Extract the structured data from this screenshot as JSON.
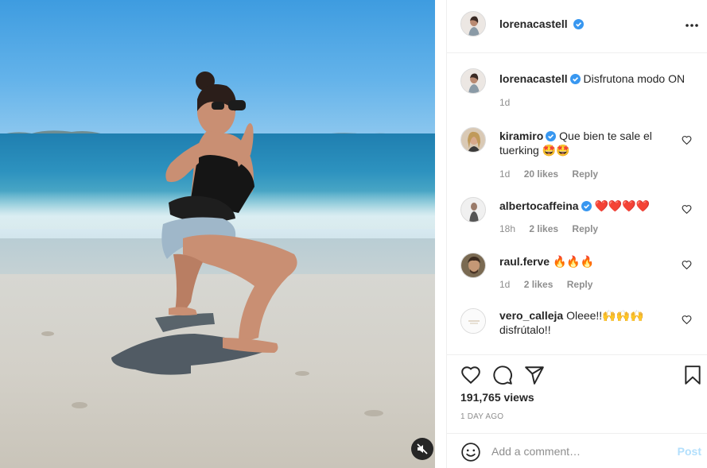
{
  "post": {
    "author": "lorenacastell",
    "caption": "Disfrutona modo ON",
    "caption_time": "1d",
    "views": "191,765 views",
    "posted_ago": "1 DAY AGO"
  },
  "comments": [
    {
      "user": "kiramiro",
      "verified": true,
      "text": "Que bien te sale el tuerking 🤩🤩",
      "time": "1d",
      "likes": "20 likes",
      "reply": "Reply"
    },
    {
      "user": "albertocaffeina",
      "verified": true,
      "text": "❤️❤️❤️❤️",
      "time": "18h",
      "likes": "2 likes",
      "reply": "Reply"
    },
    {
      "user": "raul.ferve",
      "verified": false,
      "text": "🔥🔥🔥",
      "time": "1d",
      "likes": "2 likes",
      "reply": "Reply"
    },
    {
      "user": "vero_calleja",
      "verified": false,
      "text": "Oleee!!🙌🙌🙌 disfrútalo!!",
      "time": "",
      "likes": "",
      "reply": ""
    }
  ],
  "add_comment": {
    "placeholder": "Add a comment…",
    "post_label": "Post"
  },
  "icons": {
    "more": "more-options-icon",
    "like": "heart-icon",
    "comment": "comment-icon",
    "share": "share-icon",
    "save": "bookmark-icon",
    "emoji": "smile-icon",
    "mute": "muted-speaker-icon",
    "verified": "verified-badge-icon"
  },
  "colors": {
    "verified": "#3897f0",
    "post_disabled": "#b2dffc",
    "secondary_text": "#8e8e8e",
    "heart_red": "#ed4956"
  }
}
